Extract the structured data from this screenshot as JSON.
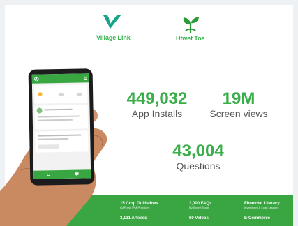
{
  "brands": {
    "village_link": "Village Link",
    "htwet_toe": "Htwet Toe"
  },
  "colors": {
    "brand_green": "#36b24a",
    "bar_green": "#39a642",
    "teal": "#15a58a"
  },
  "stats": [
    {
      "value": "449,032",
      "label": "App Installs"
    },
    {
      "value": "19M",
      "label": "Screen views"
    },
    {
      "value": "43,004",
      "label": "Questions"
    }
  ],
  "features": [
    {
      "title": "15 Crop Guidelines",
      "subtitle": "GAP and IPM Practices"
    },
    {
      "title": "3,000 FAQs",
      "subtitle": "By Expert Team"
    },
    {
      "title": "Financial Literacy",
      "subtitle": "Investment & Loan Lessons"
    },
    {
      "title": "3,121 Articles",
      "subtitle": ""
    },
    {
      "title": "60 Videos",
      "subtitle": ""
    },
    {
      "title": "E-Commerce",
      "subtitle": ""
    }
  ]
}
